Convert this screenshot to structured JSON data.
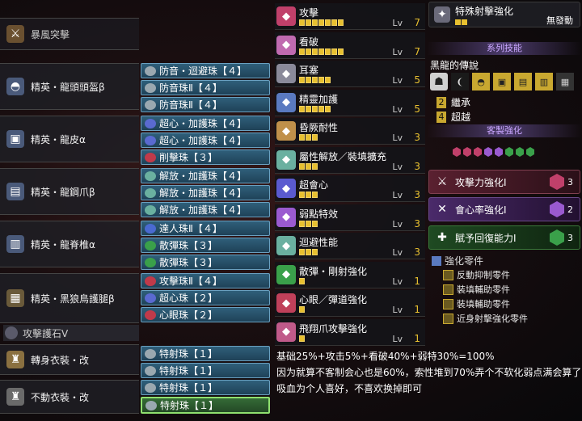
{
  "weapon": {
    "name": "暴風突擊",
    "icon": "weapon-icon"
  },
  "armor": [
    {
      "name": "精英・龍頭頭盔β",
      "icon": "helmet-icon",
      "decos": [
        {
          "label": "防音・迴避珠【４】",
          "color": "#9aa8b0"
        },
        {
          "label": "防音珠Ⅱ【４】",
          "color": "#9aa8b0"
        },
        {
          "label": "防音珠Ⅱ【４】",
          "color": "#9aa8b0"
        }
      ]
    },
    {
      "name": "精英・龍皮α",
      "icon": "chest-icon",
      "decos": [
        {
          "label": "超心・加護珠【４】",
          "color": "#5a6ad0"
        },
        {
          "label": "超心・加護珠【４】",
          "color": "#5a6ad0"
        },
        {
          "label": "削擊珠【３】",
          "color": "#c03a4a"
        }
      ]
    },
    {
      "name": "精英・龍鋼爪β",
      "icon": "arms-icon",
      "decos": [
        {
          "label": "解放・加護珠【４】",
          "color": "#6ab0a0"
        },
        {
          "label": "解放・加護珠【４】",
          "color": "#6ab0a0"
        },
        {
          "label": "解放・加護珠【４】",
          "color": "#6ab0a0"
        }
      ]
    },
    {
      "name": "精英・龍脊椎α",
      "icon": "waist-icon",
      "decos": [
        {
          "label": "達人珠Ⅱ【４】",
          "color": "#4a6ad0"
        },
        {
          "label": "散彈珠【３】",
          "color": "#3aa04a"
        },
        {
          "label": "散彈珠【３】",
          "color": "#3aa04a"
        }
      ]
    },
    {
      "name": "精英・黑狼鳥護腿β",
      "icon": "legs-icon",
      "decos": [
        {
          "label": "攻擊珠Ⅱ【４】",
          "color": "#c03a4a"
        },
        {
          "label": "超心珠【２】",
          "color": "#5a6ad0"
        },
        {
          "label": "心眼珠【２】",
          "color": "#c03a4a"
        }
      ]
    }
  ],
  "charm": {
    "name": "攻擊護石Ⅴ"
  },
  "mantles": [
    {
      "name": "轉身衣裝・改",
      "deco": "特射珠【１】"
    },
    {
      "name": "不動衣裝・改",
      "deco": "特射珠【１】"
    }
  ],
  "mantle_extra_deco": "特射珠【１】",
  "skills": [
    {
      "name": "攻擊",
      "level": 7,
      "max": 7,
      "color": "#c0406a",
      "icon": "attack-icon"
    },
    {
      "name": "看破",
      "level": 7,
      "max": 7,
      "color": "#c06ab0",
      "icon": "crit-eye-icon"
    },
    {
      "name": "耳塞",
      "level": 5,
      "max": 5,
      "color": "#8a8a9a",
      "icon": "earplug-icon"
    },
    {
      "name": "精靈加護",
      "level": 5,
      "max": 5,
      "color": "#5a7ac0",
      "icon": "divine-blessing-icon"
    },
    {
      "name": "昏厥耐性",
      "level": 3,
      "max": 3,
      "color": "#c0904a",
      "icon": "stun-icon"
    },
    {
      "name": "屬性解放／裝填擴充",
      "level": 3,
      "max": 3,
      "color": "#6ab0a0",
      "icon": "free-elem-icon"
    },
    {
      "name": "超會心",
      "level": 3,
      "max": 3,
      "color": "#5a5ad0",
      "icon": "crit-boost-icon"
    },
    {
      "name": "弱點特效",
      "level": 3,
      "max": 3,
      "color": "#9a5ad0",
      "icon": "weakness-icon"
    },
    {
      "name": "迴避性能",
      "level": 3,
      "max": 3,
      "color": "#6ab0a0",
      "icon": "evade-icon"
    },
    {
      "name": "散彈・剛射強化",
      "level": 1,
      "max": 1,
      "color": "#3aa04a",
      "icon": "spread-icon"
    },
    {
      "name": "心眼／彈道強化",
      "level": 1,
      "max": 1,
      "color": "#c0405a",
      "icon": "mind-eye-icon"
    },
    {
      "name": "飛翔爪攻擊強化",
      "level": 1,
      "max": 1,
      "color": "#c05a8a",
      "icon": "clutch-icon"
    }
  ],
  "lv_label": "Lv",
  "special_skill": {
    "name": "特殊射擊強化",
    "status": "無發動",
    "icon": "special-shot-icon"
  },
  "series_header": "系列技能",
  "series": {
    "name": "黑龍的傳說",
    "bonuses": [
      {
        "count": "2",
        "name": "繼承"
      },
      {
        "count": "4",
        "name": "超越"
      }
    ]
  },
  "custom_header": "客製強化",
  "augments": [
    {
      "name": "攻擊力強化Ⅰ",
      "count": "3",
      "color": "#c0406a",
      "bg": "#4a1a2a"
    },
    {
      "name": "會心率強化Ⅰ",
      "count": "2",
      "color": "#9a5ad0",
      "bg": "#3a1a4a"
    },
    {
      "name": "賦予回復能力Ⅰ",
      "count": "3",
      "color": "#3aa04a",
      "bg": "#1a3a1a"
    }
  ],
  "parts_header": "強化零件",
  "parts": [
    "反動抑制零件",
    "裝填輔助零件",
    "裝填輔助零件",
    "近身射擊強化零件"
  ],
  "note": [
    "基础25%+攻击5%+看破40%+弱特30%=100%",
    "因为就算不客制会心也是60%，索性堆到70%弄个不软化弱点满会算了",
    "吸血为个人喜好，不喜欢换掉即可"
  ]
}
